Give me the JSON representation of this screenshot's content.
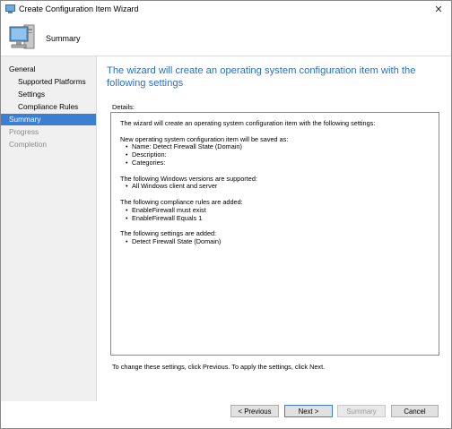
{
  "window": {
    "title": "Create Configuration Item Wizard",
    "close_glyph": "✕"
  },
  "header": {
    "title": "Summary",
    "icon": "computer-monitor-icon"
  },
  "sidebar": {
    "items": [
      {
        "label": "General",
        "level": 0,
        "state": "normal"
      },
      {
        "label": "Supported Platforms",
        "level": 1,
        "state": "normal"
      },
      {
        "label": "Settings",
        "level": 1,
        "state": "normal"
      },
      {
        "label": "Compliance Rules",
        "level": 1,
        "state": "normal"
      },
      {
        "label": "Summary",
        "level": 0,
        "state": "active"
      },
      {
        "label": "Progress",
        "level": 0,
        "state": "dim"
      },
      {
        "label": "Completion",
        "level": 0,
        "state": "dim"
      }
    ]
  },
  "main": {
    "heading": "The wizard will create an operating system configuration item with the following settings",
    "details_label": "Details:",
    "details": {
      "intro": "The wizard will create an operating system configuration item with the following settings:",
      "saved_as_header": "New operating system configuration item will be saved as:",
      "saved_as_items": [
        "Name: Detect Firewall State (Domain)",
        "Description:",
        "Categories:"
      ],
      "versions_header": "The following Windows versions are supported:",
      "versions_items": [
        "All Windows client and server"
      ],
      "rules_header": "The following compliance rules are added:",
      "rules_items": [
        "EnableFirewall must exist",
        "EnableFirewall Equals 1"
      ],
      "settings_header": "The following settings are added:",
      "settings_items": [
        "Detect Firewall State (Domain)"
      ]
    },
    "hint": "To change these settings, click Previous. To apply the settings, click Next."
  },
  "footer": {
    "previous_label": "< Previous",
    "next_label": "Next >",
    "summary_label": "Summary",
    "cancel_label": "Cancel"
  },
  "colors": {
    "accent": "#3a7fd1",
    "heading": "#2a6fc0",
    "sidebar_bg": "#f0f0f0"
  }
}
